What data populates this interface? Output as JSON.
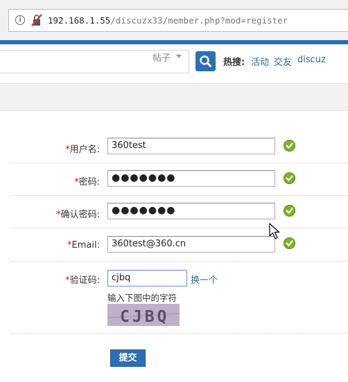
{
  "browser": {
    "url_host": "192.168.1.55",
    "url_path": "/discuzx33/member.php?mod=register"
  },
  "search": {
    "type_label": "帖子",
    "hot_label": "热搜:",
    "hot_links": [
      "活动",
      "交友",
      "discuz"
    ]
  },
  "form": {
    "required_mark": "*",
    "username": {
      "label": "用户名:",
      "value": "360test"
    },
    "password": {
      "label": "密码:",
      "value": "●●●●●●●"
    },
    "confirm_password": {
      "label": "确认密码:",
      "value": "●●●●●●●"
    },
    "email": {
      "label": "Email:",
      "value": "360test@360.cn"
    },
    "captcha": {
      "label": "验证码:",
      "value": "cjbq",
      "change_link": "换一个",
      "hint": "输入下图中的字符",
      "image_text": "CJBQ"
    },
    "submit_label": "提交"
  },
  "colors": {
    "brand_blue": "#2b6fb6",
    "link": "#336699",
    "required": "#ff0000",
    "valid": "#7cb32c"
  }
}
